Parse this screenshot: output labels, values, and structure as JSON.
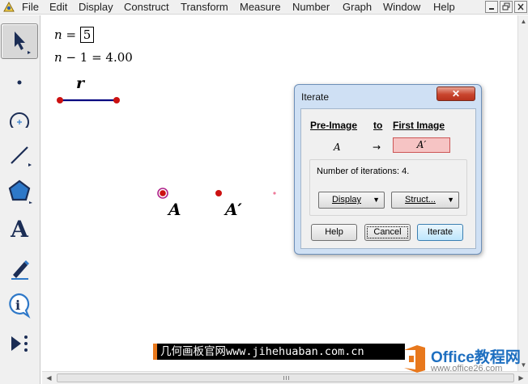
{
  "menubar": {
    "items": [
      "File",
      "Edit",
      "Display",
      "Construct",
      "Transform",
      "Measure",
      "Number",
      "Graph",
      "Window",
      "Help"
    ],
    "window_controls": [
      "minimize",
      "restore",
      "close"
    ]
  },
  "toolbar": {
    "tools": [
      "arrow-select",
      "point",
      "compass",
      "straightedge",
      "polygon",
      "text",
      "marker",
      "information",
      "custom-tools"
    ],
    "text_tool_glyph": "A",
    "info_tool_glyph": "i"
  },
  "sketch": {
    "parameter": {
      "name": "n",
      "equals": " = ",
      "value": "5"
    },
    "calculation": {
      "name": "n",
      "operator": " − ",
      "rest": "1 = 4.00"
    },
    "segment_label": "r",
    "point_a_label": "A",
    "point_a_prime_label": "A′"
  },
  "dialog": {
    "title": "Iterate",
    "close_label": "✕",
    "col_pre_image": "Pre-Image",
    "col_to": "to",
    "col_first_image": "First Image",
    "pre_image_value": "A",
    "arrow": "→",
    "first_image_value": "A′",
    "iterations_text": "Number of iterations: 4.",
    "display_dropdown": "Display",
    "structure_dropdown": "Struct...",
    "help_button": "Help",
    "cancel_button": "Cancel",
    "iterate_button": "Iterate"
  },
  "watermarks": {
    "banner_text": "几何画板官网www.jihehuaban.com.cn",
    "office_title": "Office教程网",
    "office_site": "www.office26.com"
  },
  "colors": {
    "point_red": "#cc1111",
    "point_magenta": "#b0258c",
    "segment_blue": "#000080",
    "highlight_field": "#f6c4c4",
    "close_button_red": "#c9452e",
    "office_orange": "#e8781c",
    "office_blue": "#1e6fc0"
  }
}
